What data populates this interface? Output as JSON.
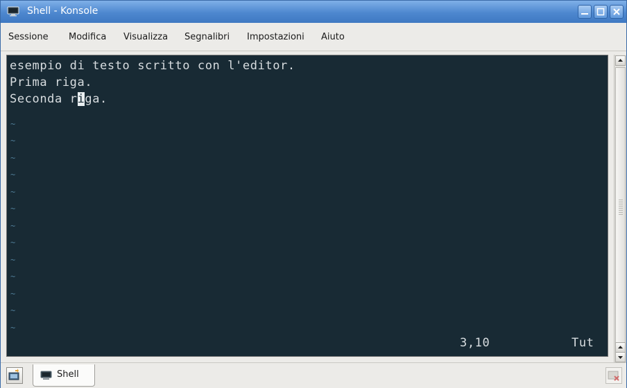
{
  "window": {
    "title": "Shell - Konsole",
    "icon": "terminal-icon",
    "controls": [
      "minimize-icon",
      "maximize-icon",
      "close-icon"
    ]
  },
  "menu": {
    "items": [
      {
        "label": "Sessione"
      },
      {
        "label": "Modifica"
      },
      {
        "label": "Visualizza"
      },
      {
        "label": "Segnalibri"
      },
      {
        "label": "Impostazioni"
      },
      {
        "label": "Aiuto"
      }
    ]
  },
  "terminal": {
    "lines": [
      "esempio di testo scritto con l'editor.",
      "Prima riga.",
      {
        "before": "Seconda r",
        "cursor": "i",
        "after": "ga."
      }
    ],
    "tilde": "~",
    "tilde_count": 13,
    "status_position": "3,10",
    "status_percent": "Tut",
    "colors": {
      "background": "#182a34",
      "text": "#d8dde0",
      "tilde": "#4f7c96"
    }
  },
  "tabs": {
    "items": [
      {
        "label": "Shell",
        "icon": "terminal-icon"
      }
    ],
    "new_tab_icon": "new-session-icon",
    "close_tab_icon": "close-session-icon"
  },
  "theme": {
    "titlebar_color": "#4d87cf"
  }
}
